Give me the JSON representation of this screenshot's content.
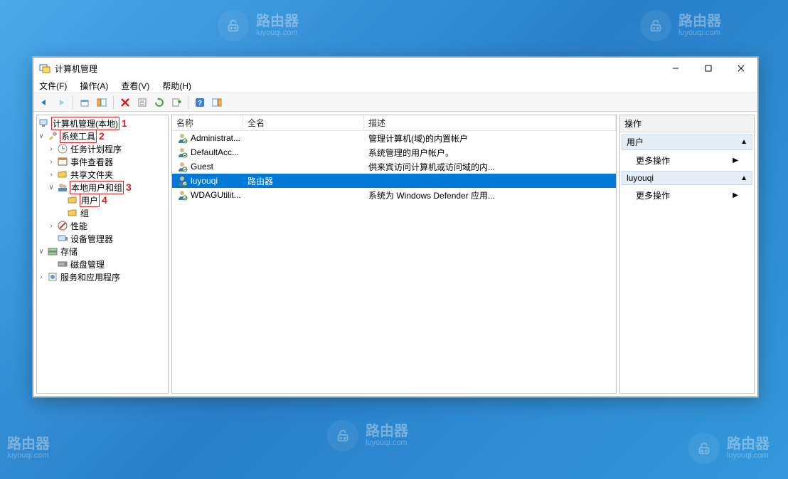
{
  "watermark": {
    "title": "路由器",
    "sub": "luyouqi.com"
  },
  "window": {
    "title": "计算机管理",
    "menu": {
      "file": "文件(F)",
      "action": "操作(A)",
      "view": "查看(V)",
      "help": "帮助(H)"
    }
  },
  "tree": {
    "root": {
      "label": "计算机管理(本地)",
      "num": "1"
    },
    "system": {
      "label": "系统工具",
      "num": "2"
    },
    "task": {
      "label": "任务计划程序"
    },
    "event": {
      "label": "事件查看器"
    },
    "shared": {
      "label": "共享文件夹"
    },
    "localusers": {
      "label": "本地用户和组",
      "num": "3"
    },
    "users": {
      "label": "用户",
      "num": "4"
    },
    "groups": {
      "label": "组"
    },
    "perf": {
      "label": "性能"
    },
    "devmgr": {
      "label": "设备管理器"
    },
    "storage": {
      "label": "存储"
    },
    "diskmgmt": {
      "label": "磁盘管理"
    },
    "services": {
      "label": "服务和应用程序"
    }
  },
  "list": {
    "columns": {
      "name": "名称",
      "full": "全名",
      "desc": "描述"
    },
    "rows": [
      {
        "name": "Administrat...",
        "full": "",
        "desc": "管理计算机(域)的内置帐户"
      },
      {
        "name": "DefaultAcc...",
        "full": "",
        "desc": "系统管理的用户帐户。"
      },
      {
        "name": "Guest",
        "full": "",
        "desc": "供来宾访问计算机或访问域的内..."
      },
      {
        "name": "luyouqi",
        "full": "路由器",
        "desc": "",
        "selected": true
      },
      {
        "name": "WDAGUtilit...",
        "full": "",
        "desc": "系统为 Windows Defender 应用..."
      }
    ]
  },
  "actions": {
    "title": "操作",
    "groups": [
      {
        "header": "用户",
        "items": [
          "更多操作"
        ]
      },
      {
        "header": "luyouqi",
        "items": [
          "更多操作"
        ]
      }
    ]
  }
}
